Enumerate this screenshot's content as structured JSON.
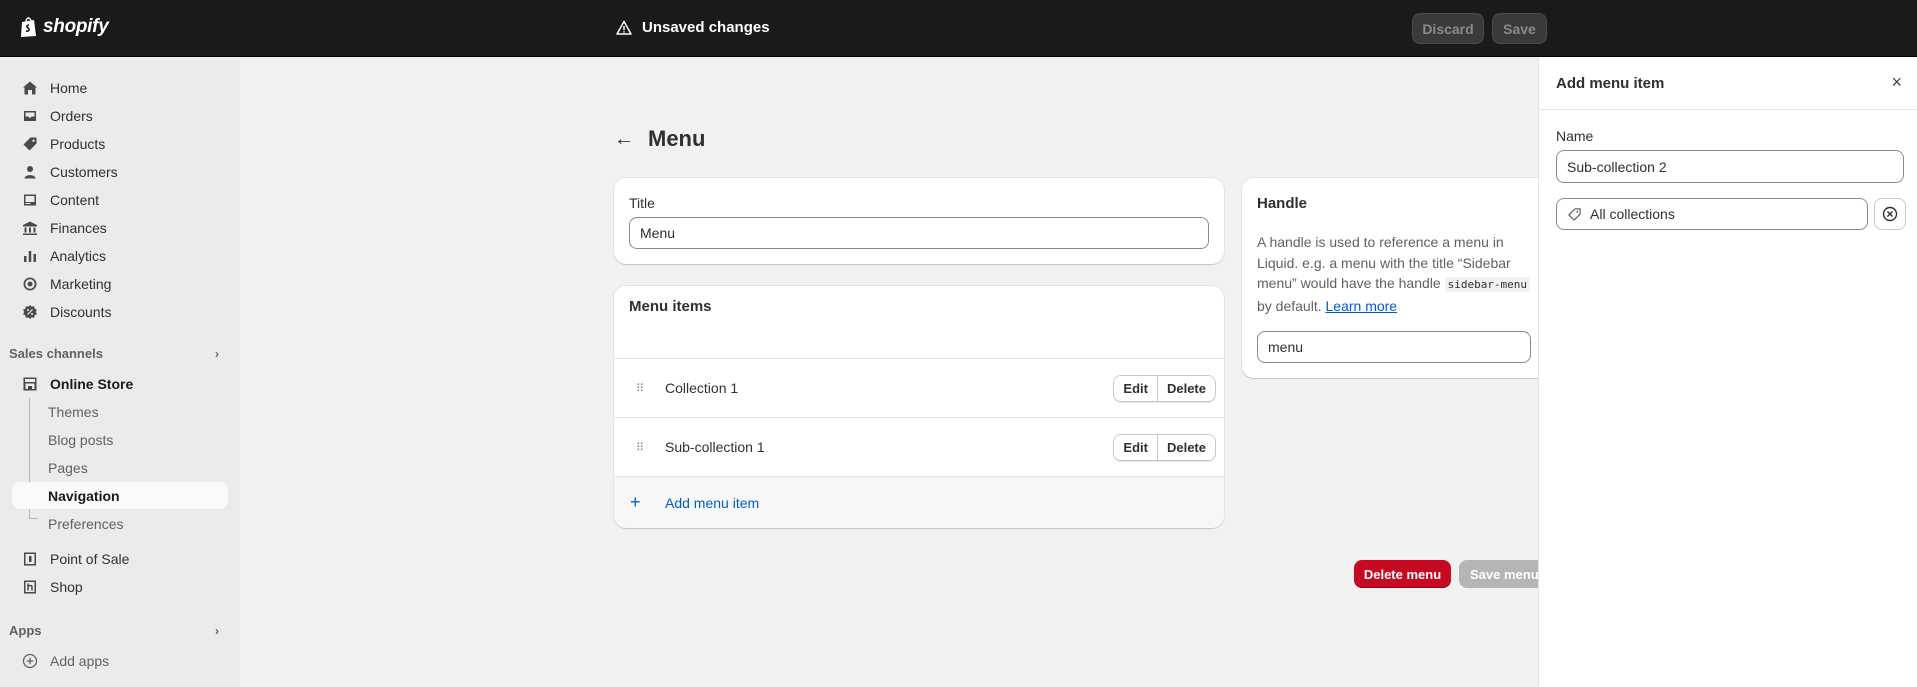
{
  "topbar": {
    "brand": "shopify",
    "unsaved_label": "Unsaved changes",
    "discard_label": "Discard",
    "save_label": "Save"
  },
  "sidebar": {
    "items": [
      {
        "label": "Home",
        "icon": "home-icon"
      },
      {
        "label": "Orders",
        "icon": "inbox-icon"
      },
      {
        "label": "Products",
        "icon": "tag-icon"
      },
      {
        "label": "Customers",
        "icon": "person-icon"
      },
      {
        "label": "Content",
        "icon": "content-icon"
      },
      {
        "label": "Finances",
        "icon": "bank-icon"
      },
      {
        "label": "Analytics",
        "icon": "bar-chart-icon"
      },
      {
        "label": "Marketing",
        "icon": "target-icon"
      },
      {
        "label": "Discounts",
        "icon": "discount-icon"
      }
    ],
    "sales_channels_label": "Sales channels",
    "online_store_label": "Online Store",
    "sub_items": [
      "Themes",
      "Blog posts",
      "Pages",
      "Navigation",
      "Preferences"
    ],
    "point_of_sale_label": "Point of Sale",
    "shop_label": "Shop",
    "apps_label": "Apps",
    "add_apps_label": "Add apps"
  },
  "main": {
    "title": "Menu",
    "title_card": {
      "label": "Title",
      "value": "Menu"
    },
    "menu_items_card": {
      "heading": "Menu items",
      "items": [
        {
          "label": "Collection 1",
          "edit": "Edit",
          "delete": "Delete"
        },
        {
          "label": "Sub-collection 1",
          "edit": "Edit",
          "delete": "Delete"
        }
      ],
      "add_label": "Add menu item"
    },
    "handle_card": {
      "heading": "Handle",
      "desc_1": "A handle is used to reference a menu in Liquid. e.g. a menu with the title “Sidebar menu” would have the handle",
      "code": "sidebar-menu",
      "desc_2": "by default.",
      "learn_more": "Learn more",
      "value": "menu"
    },
    "delete_menu_label": "Delete menu",
    "save_menu_label": "Save menu"
  },
  "panel": {
    "title": "Add menu item",
    "name_label": "Name",
    "name_value": "Sub-collection 2",
    "link_value": "All collections"
  }
}
